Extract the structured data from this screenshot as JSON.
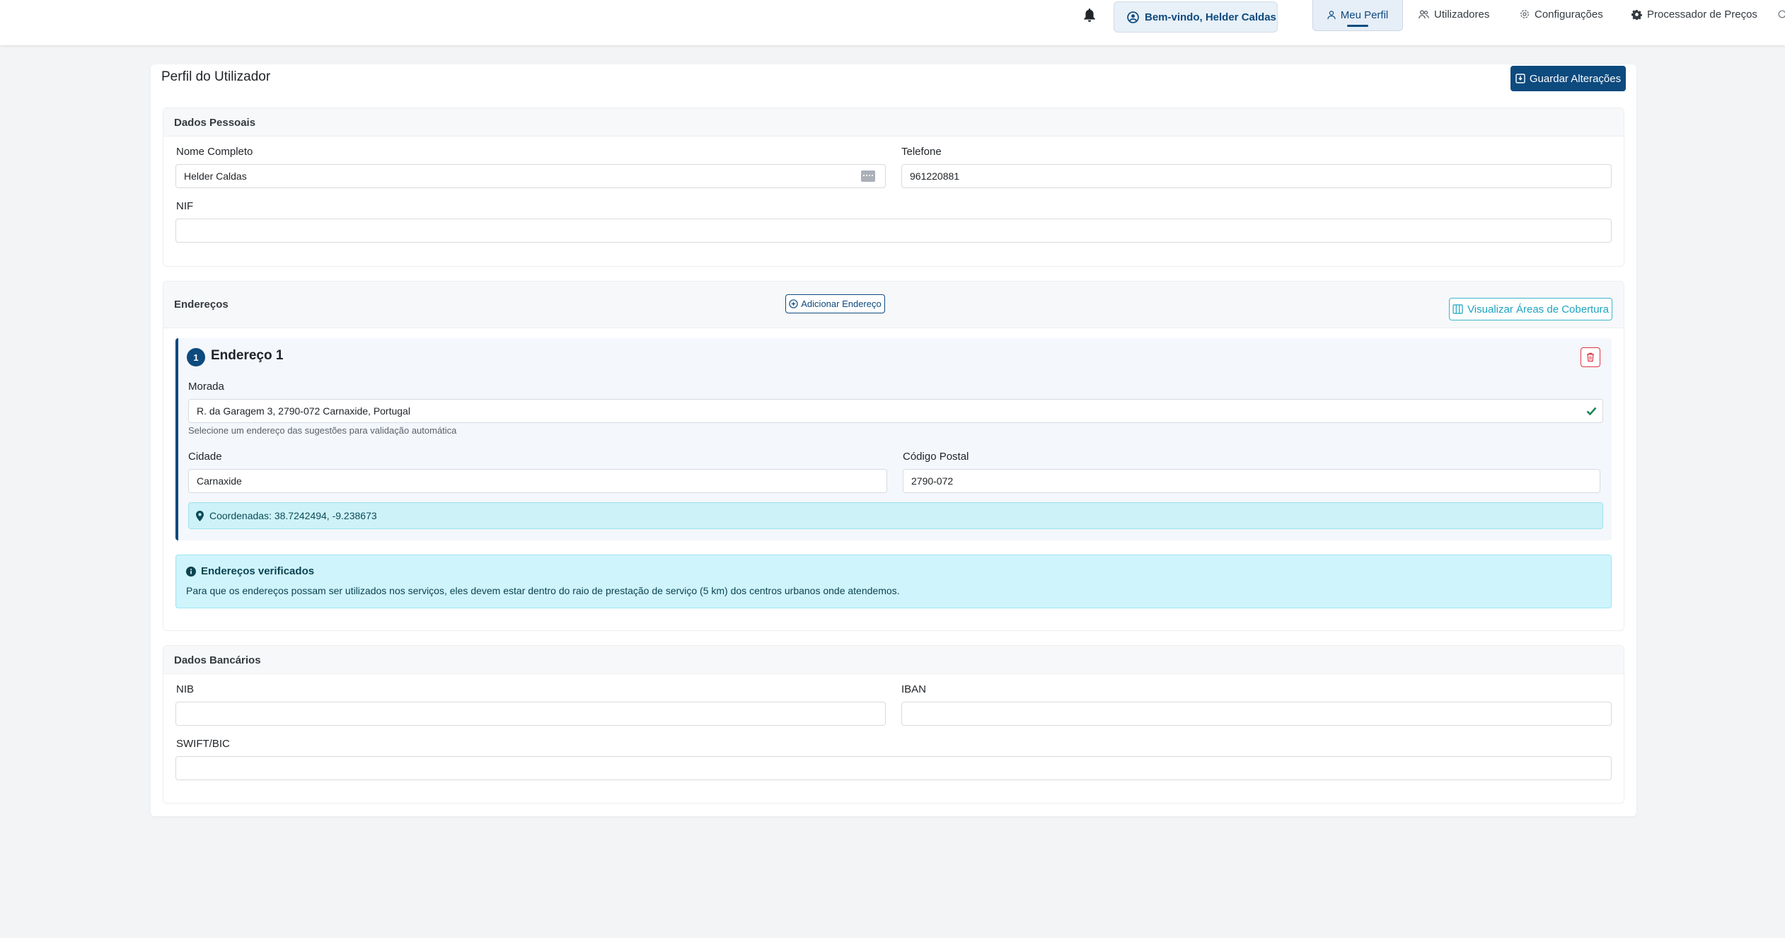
{
  "navbar": {
    "welcome": "Bem-vindo, Helder Caldas",
    "items": [
      {
        "label": "Meu Perfil"
      },
      {
        "label": "Utilizadores"
      },
      {
        "label": "Configurações"
      },
      {
        "label": "Processador de Preços"
      }
    ]
  },
  "page": {
    "title": "Perfil do Utilizador",
    "save_label": "Guardar Alterações"
  },
  "personal": {
    "title": "Dados Pessoais",
    "name_label": "Nome Completo",
    "name_value": "Helder Caldas",
    "phone_label": "Telefone",
    "phone_value": "961220881",
    "nif_label": "NIF",
    "nif_value": ""
  },
  "addresses": {
    "title": "Endereços",
    "add_label": "Adicionar Endereço",
    "coverage_label": "Visualizar Áreas de Cobertura",
    "items": [
      {
        "number": "1",
        "title": "Endereço 1",
        "morada_label": "Morada",
        "morada_value": "R. da Garagem 3, 2790-072 Carnaxide, Portugal",
        "hint": "Selecione um endereço das sugestões para validação automática",
        "city_label": "Cidade",
        "city_value": "Carnaxide",
        "postal_label": "Código Postal",
        "postal_value": "2790-072",
        "coords": "Coordenadas: 38.7242494, -9.238673"
      }
    ],
    "info_title": "Endereços verificados",
    "info_text": "Para que os endereços possam ser utilizados nos serviços, eles devem estar dentro do raio de prestação de serviço (5 km) dos centros urbanos onde atendemos."
  },
  "bank": {
    "title": "Dados Bancários",
    "nib_label": "NIB",
    "nib_value": "",
    "iban_label": "IBAN",
    "iban_value": "",
    "swift_label": "SWIFT/BIC",
    "swift_value": ""
  },
  "colors": {
    "primary": "#0d4a7e",
    "info_bg": "#cff4fc",
    "danger": "#dc3545",
    "success": "#198754"
  }
}
